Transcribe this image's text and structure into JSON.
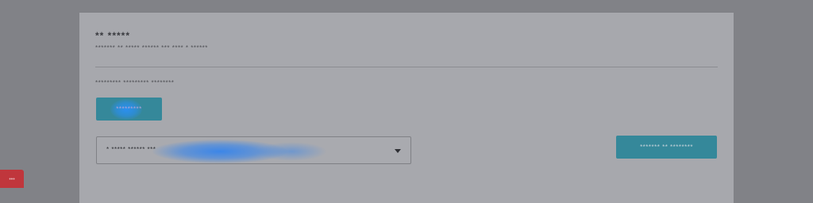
{
  "card": {
    "title": "** *****",
    "subtitle": "******* ** ***** ****** *** **** * ******",
    "section_label": "********* ********* ********",
    "option_button_label": "*********",
    "select": {
      "value": "* ***** ****** ***"
    },
    "submit_button_label": "******* ** ********"
  },
  "side_tab": {
    "label": "•••"
  },
  "colors": {
    "overlay": "#818287",
    "card": "#a7a8ad",
    "accent": "#35889a",
    "highlight_blue": "#2a8ff0",
    "side_tab": "#c0363c"
  }
}
